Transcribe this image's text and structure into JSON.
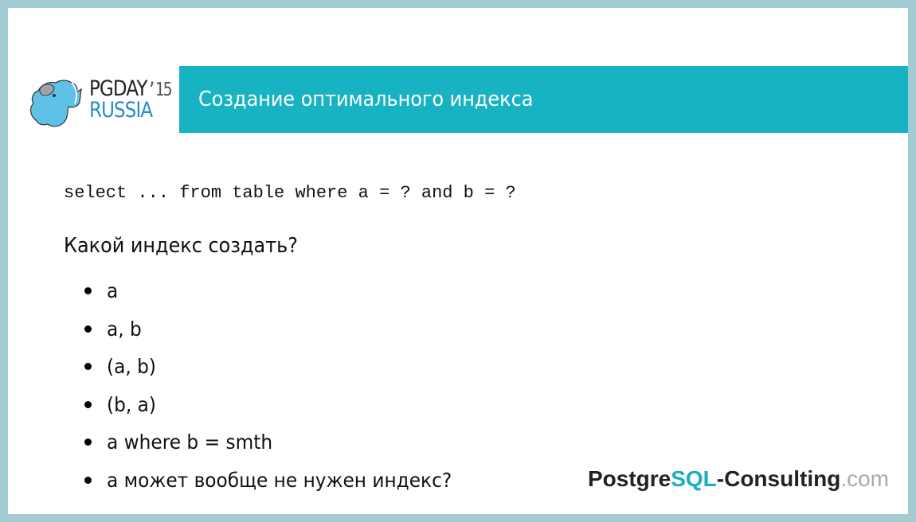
{
  "logo": {
    "line1": "PGDAY",
    "year": "’15",
    "line2": "RUSSIA"
  },
  "header": {
    "title": "Создание оптимального индекса"
  },
  "content": {
    "code": "select ... from table where a = ? and b = ?",
    "question": "Какой индекс создать?",
    "options": [
      "a",
      "a, b",
      "(a, b)",
      "(b, a)",
      "a where b = smth",
      "а может вообще не нужен индекс?"
    ]
  },
  "footer": {
    "brand_part1": "Postgre",
    "brand_part2": "SQL",
    "brand_part3": "-Consulting",
    "brand_part4": ".com"
  },
  "colors": {
    "frame": "#a3cbd3",
    "title_bar": "#18b3c2",
    "brand_accent": "#1aaebf",
    "logo_blue": "#2a8cc4"
  }
}
